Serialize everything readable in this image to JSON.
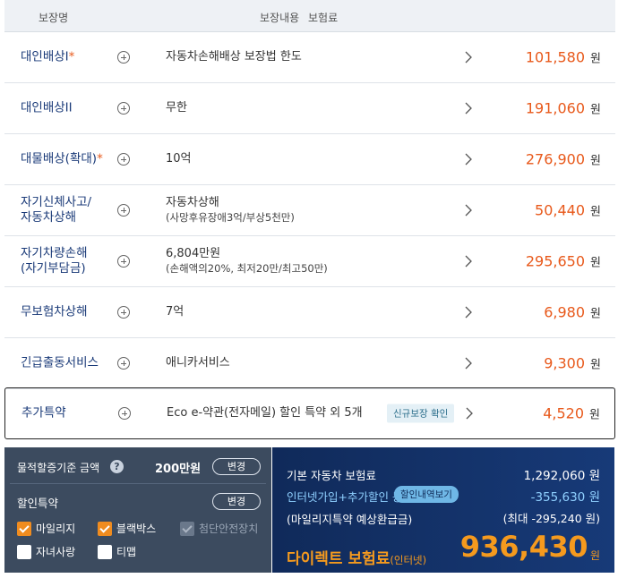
{
  "table": {
    "header": {
      "name": "보장명",
      "content": "보장내용",
      "premium": "보험료"
    },
    "currency": "원",
    "rows": [
      {
        "name": "대인배상I",
        "required": "*",
        "desc": "자동차손해배상 보장법 한도",
        "sub": "",
        "price": "101,580"
      },
      {
        "name": "대인배상II",
        "required": "",
        "desc": "무한",
        "sub": "",
        "price": "191,060"
      },
      {
        "name": "대물배상(확대)",
        "required": "*",
        "desc": "10억",
        "sub": "",
        "price": "276,900"
      },
      {
        "name": "자기신체사고/",
        "name2": "자동차상해",
        "required": "",
        "desc": "자동차상해",
        "sub": "(사망후유장애3억/부상5천만)",
        "price": "50,440"
      },
      {
        "name": "자기차량손해",
        "name2": "(자기부담금)",
        "required": "",
        "desc": "6,804만원",
        "sub": "(손해액의20%, 최저20만/최고50만)",
        "price": "295,650"
      },
      {
        "name": "무보험차상해",
        "required": "",
        "desc": "7억",
        "sub": "",
        "price": "6,980"
      },
      {
        "name": "긴급출동서비스",
        "required": "",
        "desc": "애니카서비스",
        "sub": "",
        "price": "9,300"
      },
      {
        "name": "추가특약",
        "required": "",
        "desc": "Eco e-약관(전자메일) 할인 특약 외 5개",
        "sub": "",
        "badge": "신규보장 확인",
        "price": "4,520"
      }
    ]
  },
  "left_panel": {
    "mileage_label": "물적할증기준 금액",
    "mileage_help_icon": "?",
    "mileage_amount": "200만원",
    "change_label": "변경",
    "discount_title": "할인특약",
    "checkboxes": [
      {
        "label": "마일리지",
        "checked": true
      },
      {
        "label": "블랙박스",
        "checked": true
      },
      {
        "label": "첨단안전장치",
        "checked": true,
        "disabled": true
      },
      {
        "label": "자녀사랑",
        "checked": false
      },
      {
        "label": "티맵",
        "checked": false
      }
    ]
  },
  "right_panel": {
    "base_label": "기본 자동차 보험료",
    "base_value": "1,292,060 원",
    "discount_label": "인터넷가입+추가할인 등",
    "discount_button": "할인내역보기",
    "discount_value": "-355,630 원",
    "mileage_refund_label": "(마일리지특약 예상환급금)",
    "mileage_refund_value": "(최대 -295,240 원)",
    "direct_label": "다이렉트 보험료",
    "direct_sub": "(인터넷)",
    "total": "936,430",
    "total_unit": "원"
  },
  "colors": {
    "accent_orange": "#e8591b",
    "navy": "#1a3a78",
    "panel_gray": "#3c4b5f",
    "panel_blue": "#173a78"
  }
}
